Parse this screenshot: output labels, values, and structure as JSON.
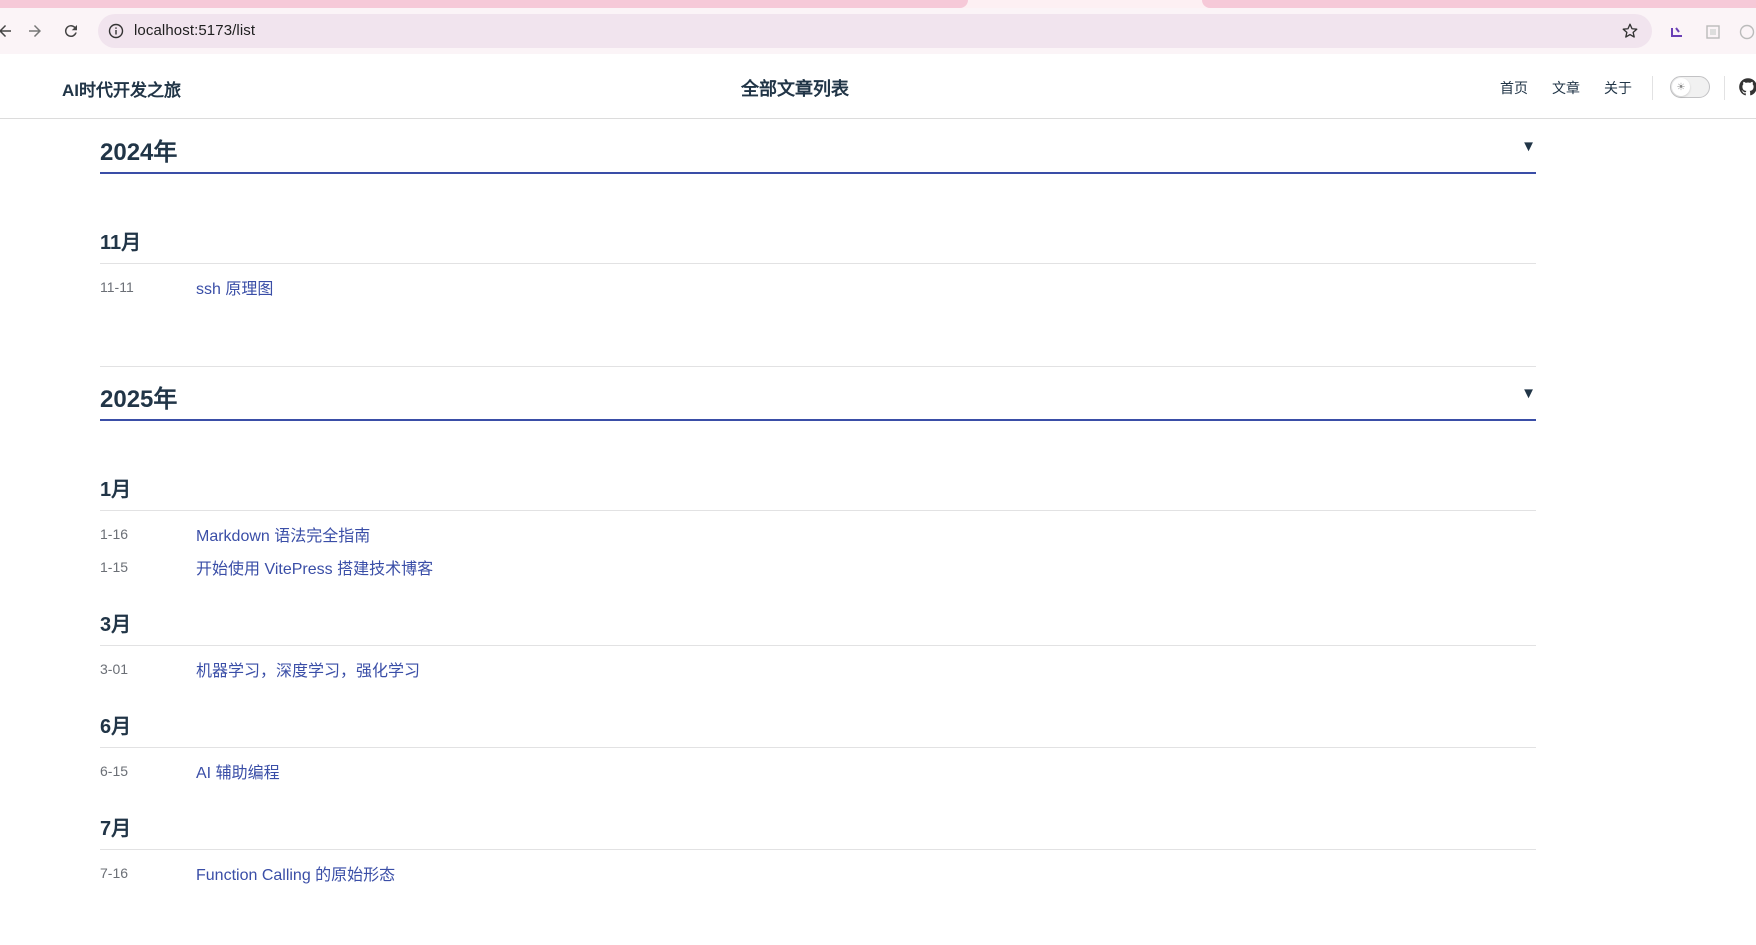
{
  "browser": {
    "url": "localhost:5173/list"
  },
  "site": {
    "brand": "AI时代开发之旅",
    "page_title": "全部文章列表",
    "menu": [
      {
        "label": "首页"
      },
      {
        "label": "文章"
      },
      {
        "label": "关于"
      }
    ]
  },
  "years": [
    {
      "label": "2024年",
      "toggle": "▼",
      "months": [
        {
          "label": "11月",
          "posts": [
            {
              "date": "11-11",
              "title": "ssh 原理图"
            }
          ]
        }
      ]
    },
    {
      "label": "2025年",
      "toggle": "▼",
      "months": [
        {
          "label": "1月",
          "posts": [
            {
              "date": "1-16",
              "title": "Markdown 语法完全指南"
            },
            {
              "date": "1-15",
              "title": "开始使用 VitePress 搭建技术博客"
            }
          ]
        },
        {
          "label": "3月",
          "posts": [
            {
              "date": "3-01",
              "title": "机器学习，深度学习，强化学习"
            }
          ]
        },
        {
          "label": "6月",
          "posts": [
            {
              "date": "6-15",
              "title": "AI 辅助编程"
            }
          ]
        },
        {
          "label": "7月",
          "posts": [
            {
              "date": "7-16",
              "title": "Function Calling 的原始形态"
            }
          ]
        }
      ]
    }
  ],
  "colors": {
    "accent": "#3a4ea7",
    "text": "#213547",
    "muted": "#6b6f76"
  }
}
